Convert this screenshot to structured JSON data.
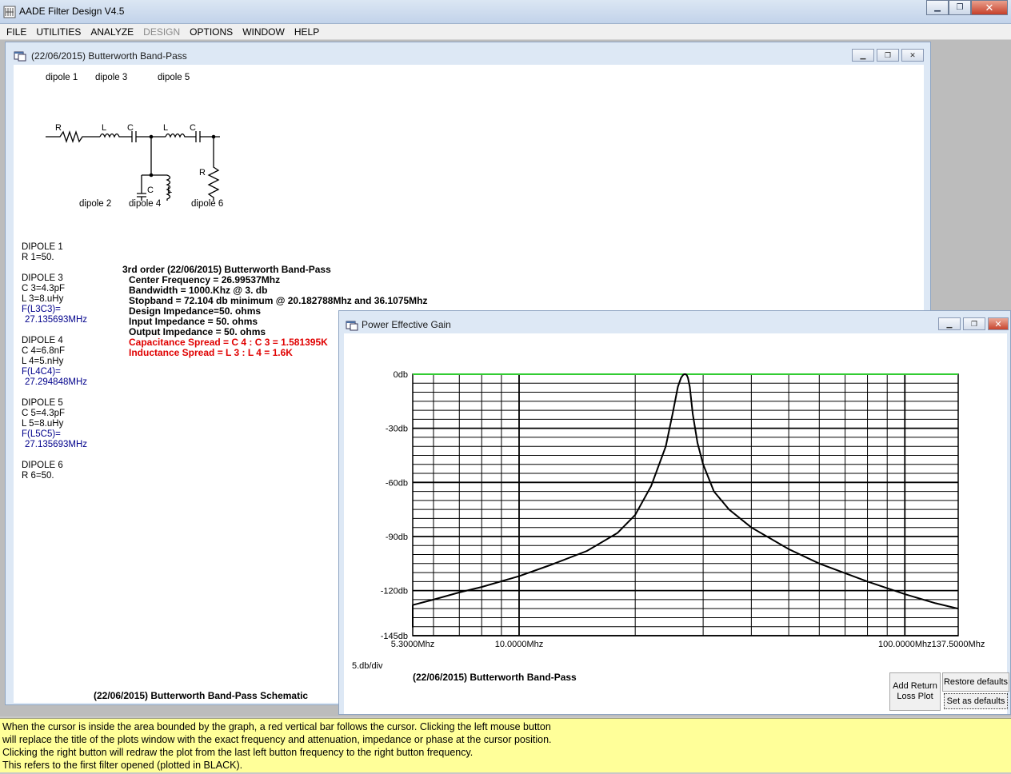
{
  "app": {
    "title": "AADE Filter Design V4.5"
  },
  "menu": [
    {
      "label": "FILE",
      "enabled": true
    },
    {
      "label": "UTILITIES",
      "enabled": true
    },
    {
      "label": "ANALYZE",
      "enabled": true
    },
    {
      "label": "DESIGN",
      "enabled": false
    },
    {
      "label": "OPTIONS",
      "enabled": true
    },
    {
      "label": "WINDOW",
      "enabled": true
    },
    {
      "label": "HELP",
      "enabled": true
    }
  ],
  "schematic": {
    "title": "(22/06/2015) Butterworth Band-Pass",
    "dipoles_top": [
      "dipole 1",
      "dipole 3",
      "dipole 5"
    ],
    "dipoles_bottom": [
      "dipole 2",
      "dipole 4",
      "dipole 6"
    ],
    "symbols": {
      "r1": "R",
      "l1": "L",
      "c1": "C",
      "l2": "L",
      "c2": "C",
      "c3": "C",
      "l3": "L",
      "r2": "R"
    },
    "components": {
      "d1": {
        "head": "DIPOLE 1",
        "lines": [
          "R 1=50."
        ]
      },
      "d3": {
        "head": "DIPOLE 3",
        "lines": [
          "C 3=4.3pF",
          "L 3=8.uHy"
        ],
        "freq_label": "F(L3C3)=",
        "freq_value": "27.135693MHz"
      },
      "d4": {
        "head": "DIPOLE 4",
        "lines": [
          "C 4=6.8nF",
          "L 4=5.nHy"
        ],
        "freq_label": "F(L4C4)=",
        "freq_value": "27.294848MHz"
      },
      "d5": {
        "head": "DIPOLE 5",
        "lines": [
          "C 5=4.3pF",
          "L 5=8.uHy"
        ],
        "freq_label": "F(L5C5)=",
        "freq_value": "27.135693MHz"
      },
      "d6": {
        "head": "DIPOLE 6",
        "lines": [
          "R 6=50."
        ]
      }
    },
    "spec": {
      "title": "3rd order (22/06/2015) Butterworth Band-Pass",
      "center": "Center Frequency = 26.99537Mhz",
      "bandwidth": "Bandwidth = 1000.Khz @ 3. db",
      "stopband": "Stopband = 72.104 db minimum @ 20.182788Mhz and 36.1075Mhz",
      "design_imp": "Design Impedance=50. ohms",
      "input_imp": "Input Impedance = 50. ohms",
      "output_imp": "Output Impedance = 50. ohms",
      "cap_spread": "Capacitance Spread = C 4 : C 3 = 1.581395K",
      "ind_spread": "Inductance Spread = L 3 : L 4 = 1.6K"
    },
    "caption": "(22/06/2015) Butterworth Band-Pass Schematic"
  },
  "plot": {
    "title": "Power Effective Gain",
    "scale": "5.db/div",
    "caption": "(22/06/2015) Butterworth Band-Pass",
    "buttons": {
      "add_return_loss": "Add Return Loss Plot",
      "restore_defaults": "Restore defaults",
      "set_as_defaults": "Set as defaults"
    }
  },
  "chart_data": {
    "type": "line",
    "x_scale": "log",
    "xlim": [
      5.3,
      137.5
    ],
    "ylim": [
      -145,
      0
    ],
    "x_tick_labels": [
      "5.3000Mhz",
      "10.0000Mhz",
      "100.0000Mhz",
      "137.5000Mhz"
    ],
    "x_tick_values": [
      5.3,
      10,
      100,
      137.5
    ],
    "y_tick_labels": [
      "0db",
      "-30db",
      "-60db",
      "-90db",
      "-120db",
      "-145db"
    ],
    "y_tick_values": [
      0,
      -30,
      -60,
      -90,
      -120,
      -145
    ],
    "grid": true,
    "reference_line": {
      "y": 0,
      "color": "#33cc33"
    },
    "series": [
      {
        "color": "#000000",
        "x": [
          5.3,
          6,
          7,
          8,
          10,
          12,
          15,
          18,
          20,
          22,
          24,
          25,
          25.8,
          26.3,
          26.6,
          26.8,
          27.0,
          27.2,
          27.4,
          27.7,
          28.2,
          29,
          30,
          32,
          35,
          40,
          50,
          60,
          80,
          100,
          120,
          137.5
        ],
        "y": [
          -128,
          -125,
          -121,
          -118,
          -112,
          -106,
          -98,
          -88,
          -78,
          -62,
          -40,
          -22,
          -7,
          -2,
          -0.5,
          0,
          0,
          -0.5,
          -2,
          -7,
          -22,
          -38,
          -50,
          -65,
          -75,
          -85,
          -97,
          -105,
          -115,
          -122,
          -127,
          -130
        ]
      }
    ],
    "colors": {
      "trace": "#000000",
      "zero_line": "#33cc33",
      "grid": "#000000"
    }
  },
  "status": {
    "lines": [
      "When the cursor is inside the area bounded by the graph, a red vertical bar follows the cursor. Clicking the left mouse button",
      "will replace the title of the plots window with the exact frequency and attenuation, impedance or phase at the cursor position.",
      "Clicking the right button will redraw the plot from the last left button frequency to the right button frequency.",
      "This refers to the first filter opened (plotted in BLACK)."
    ]
  }
}
